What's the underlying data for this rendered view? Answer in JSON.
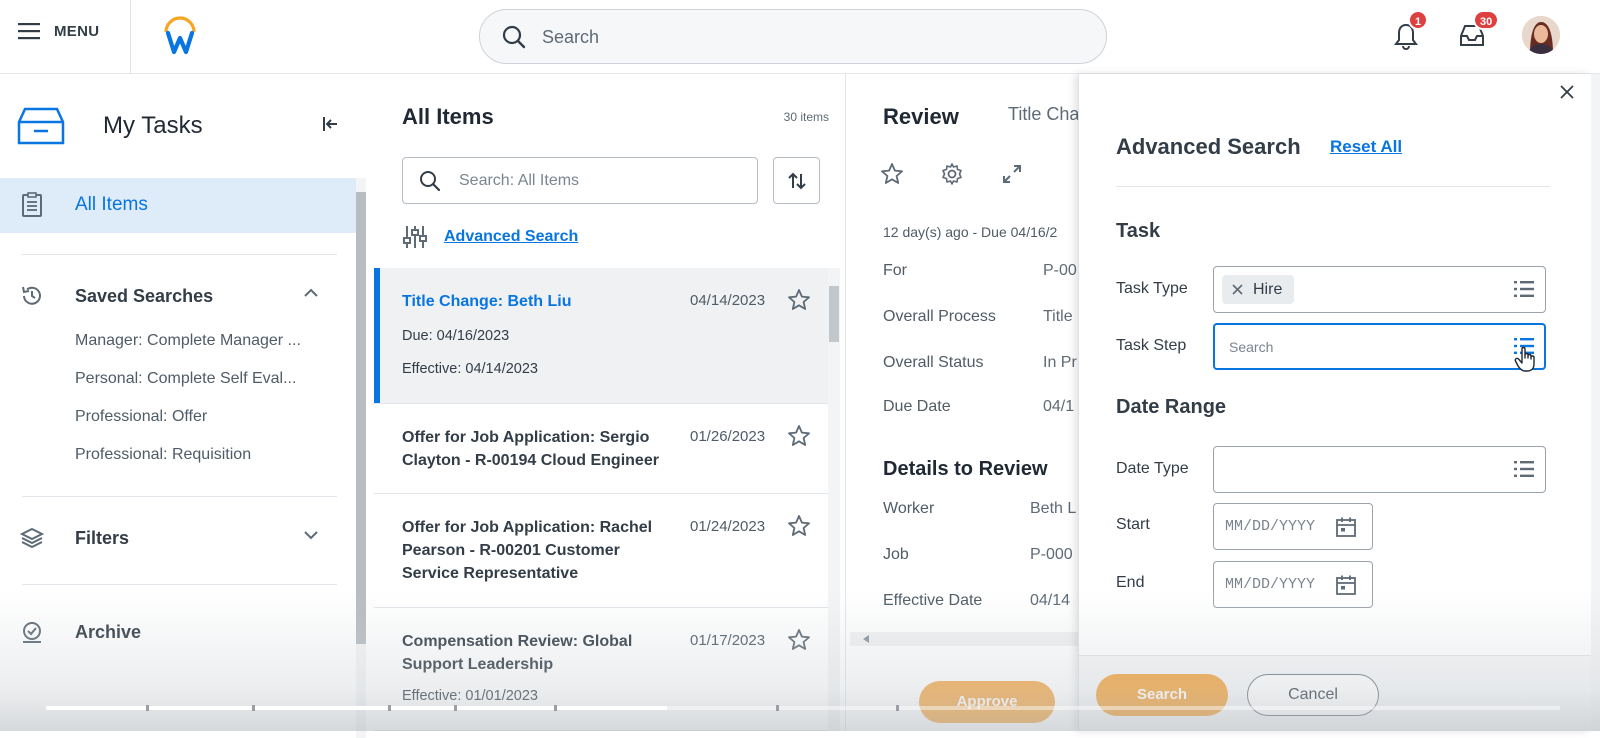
{
  "topbar": {
    "menu_label": "MENU",
    "search_placeholder": "Search",
    "notifications_count": "1",
    "inbox_count": "30"
  },
  "sidebar": {
    "title": "My Tasks",
    "all_items": "All Items",
    "saved_searches": "Saved Searches",
    "saved_items": [
      "Manager: Complete Manager ...",
      "Personal: Complete Self Eval...",
      "Professional: Offer",
      "Professional: Requisition"
    ],
    "filters": "Filters",
    "archive": "Archive"
  },
  "list": {
    "title": "All Items",
    "count": "30 items",
    "search_placeholder": "Search: All Items",
    "advanced_search": "Advanced Search",
    "items": [
      {
        "title": "Title Change: Beth Liu",
        "date": "04/14/2023",
        "due": "Due: 04/16/2023",
        "effective": "Effective: 04/14/2023"
      },
      {
        "title": "Offer for Job Application: Sergio Clayton - R-00194 Cloud Engineer",
        "date": "01/26/2023"
      },
      {
        "title": "Offer for Job Application: Rachel Pearson - R-00201 Customer Service Representative",
        "date": "01/24/2023"
      },
      {
        "title": "Compensation Review: Global Support Leadership",
        "date": "01/17/2023",
        "effective": "Effective: 01/01/2023"
      }
    ]
  },
  "review": {
    "title": "Review",
    "subtitle": "Title Cha",
    "age": "12 day(s) ago - Due 04/16/2",
    "fields": [
      {
        "label": "For",
        "value": "P-00"
      },
      {
        "label": "Overall Process",
        "value": "Title"
      },
      {
        "label": "Overall Status",
        "value": "In Pr"
      },
      {
        "label": "Due Date",
        "value": "04/1"
      }
    ],
    "details_title": "Details to Review",
    "details": [
      {
        "label": "Worker",
        "value": "Beth L"
      },
      {
        "label": "Job",
        "value": "P-000"
      },
      {
        "label": "Effective Date",
        "value": "04/14"
      }
    ],
    "approve_label": "Approve"
  },
  "advanced": {
    "title": "Advanced Search",
    "reset_all": "Reset All",
    "task_heading": "Task",
    "task_type_label": "Task Type",
    "task_type_value": "Hire",
    "task_step_label": "Task Step",
    "task_step_placeholder": "Search",
    "date_heading": "Date Range",
    "date_type_label": "Date Type",
    "start_label": "Start",
    "end_label": "End",
    "date_placeholder": "MM/DD/YYYY",
    "search_button": "Search",
    "cancel_button": "Cancel"
  },
  "video": {
    "progress_percent": 41
  }
}
